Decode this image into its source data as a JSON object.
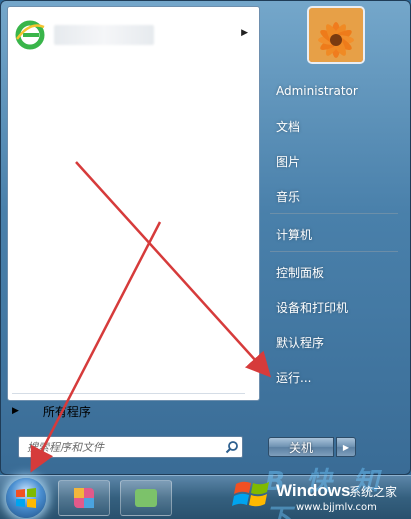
{
  "start_menu": {
    "pinned_items": [
      {
        "icon": "ie-icon",
        "label_blurred": true,
        "has_submenu": true
      }
    ],
    "all_programs_label": "所有程序",
    "search": {
      "placeholder": "搜索程序和文件"
    },
    "user_picture": "flower-avatar",
    "right_items": [
      {
        "label": "Administrator"
      },
      {
        "label": "文档"
      },
      {
        "label": "图片"
      },
      {
        "label": "音乐"
      },
      {
        "label": "计算机"
      },
      {
        "label": "控制面板"
      },
      {
        "label": "设备和打印机"
      },
      {
        "label": "默认程序"
      },
      {
        "label": "运行..."
      }
    ],
    "shutdown_label": "关机"
  },
  "taskbar": {
    "start_button": "windows-orb",
    "items": [
      "app-icon",
      "app-icon"
    ]
  },
  "watermark": {
    "brand": "Windows",
    "sub": "系统之家",
    "url": "www.bjjmlv.com",
    "big_text": "B 快 知 下"
  },
  "annotations": {
    "arrow_color": "#d63b3b"
  }
}
